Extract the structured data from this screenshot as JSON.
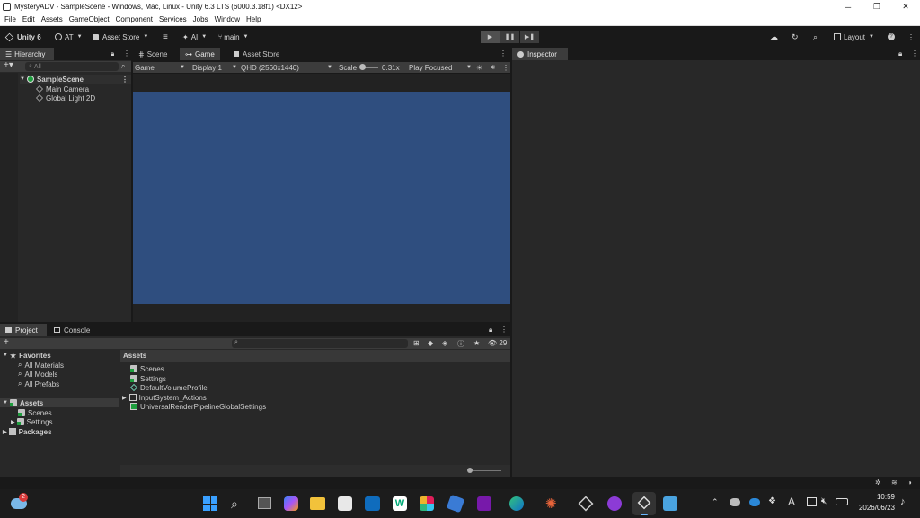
{
  "window": {
    "title": "MysteryADV - SampleScene - Windows, Mac, Linux - Unity 6.3 LTS (6000.3.18f1) <DX12>",
    "minimize": "─",
    "maximize": "❐",
    "close": "✕"
  },
  "menu": [
    "File",
    "Edit",
    "Assets",
    "GameObject",
    "Component",
    "Services",
    "Jobs",
    "Window",
    "Help"
  ],
  "toolbar": {
    "unity_label": "Unity 6",
    "account_label": "AT",
    "asset_store_label": "Asset Store",
    "ai_label": "AI",
    "branch_label": "main",
    "layout_label": "Layout"
  },
  "hierarchy": {
    "tab_label": "Hierarchy",
    "search_placeholder": "All",
    "scene_name": "SampleScene",
    "items": [
      "Main Camera",
      "Global Light 2D"
    ]
  },
  "center_tabs": [
    "Scene",
    "Game",
    "Asset Store"
  ],
  "game_bar": {
    "view_mode": "Game",
    "display": "Display 1",
    "resolution": "QHD (2560x1440)",
    "scale_label": "Scale",
    "scale_value": "0.31x",
    "play_mode": "Play Focused"
  },
  "inspector": {
    "tab_label": "Inspector"
  },
  "bottom_tabs": [
    "Project",
    "Console"
  ],
  "project": {
    "hidden_count": "29",
    "favorites_label": "Favorites",
    "favorites": [
      "All Materials",
      "All Models",
      "All Prefabs"
    ],
    "assets_label": "Assets",
    "asset_folders": [
      "Scenes",
      "Settings"
    ],
    "packages_label": "Packages",
    "breadcrumb": "Assets",
    "assets_list": [
      "Scenes",
      "Settings",
      "DefaultVolumeProfile",
      "InputSystem_Actions",
      "UniversalRenderPipelineGlobalSettings"
    ]
  },
  "taskbar": {
    "weather_badge": "2",
    "time": "10:59",
    "date": "2026/06/23",
    "ime": "A"
  },
  "colors": {
    "game_background": "#2f4e7f",
    "editor_bg": "#282828",
    "tab_active": "#3c3c3c"
  }
}
